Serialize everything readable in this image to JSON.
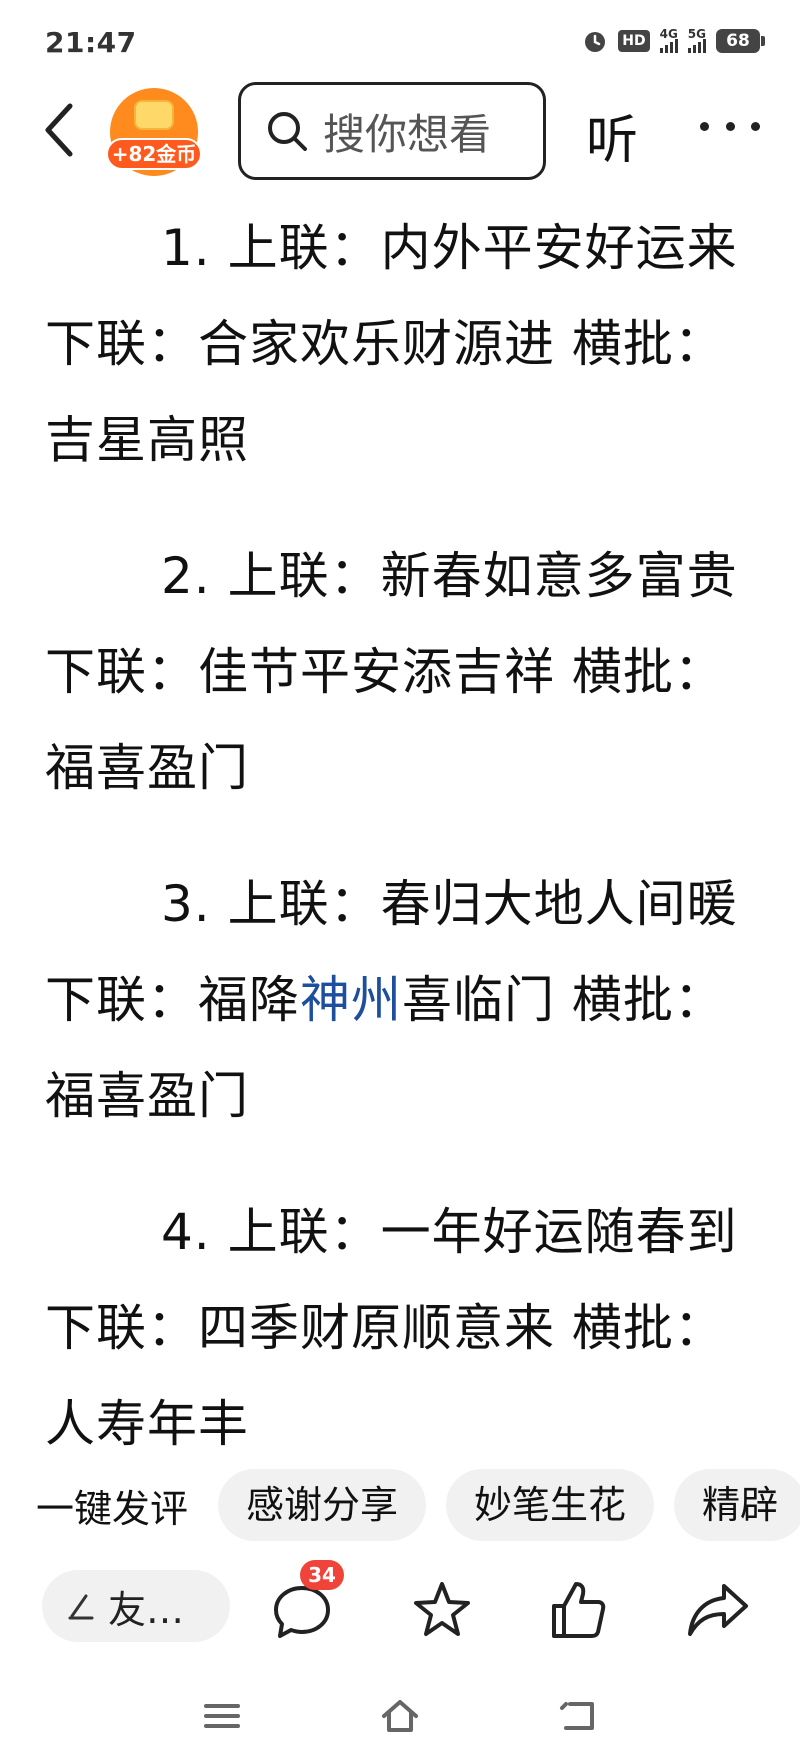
{
  "status_bar": {
    "time": "21:47",
    "hd_label": "HD",
    "network_1": "4G",
    "network_2": "5G",
    "battery": "68"
  },
  "header": {
    "back_icon": "chevron-left-icon",
    "coin_badge_label": "+82金币",
    "search_placeholder": "搜你想看",
    "listen_label": "听",
    "more_icon": "more-horizontal-icon"
  },
  "article": {
    "paragraphs": [
      {
        "text": "1. 上联：内外平安好运来 下联：合家欢乐财源进 横批：吉星高照"
      },
      {
        "text": "2. 上联：新春如意多富贵 下联：佳节平安添吉祥 横批：福喜盈门"
      },
      {
        "pre": "3. 上联：春归大地人间暖 下联：福降",
        "keyword": "神州",
        "post": "喜临门 横批：福喜盈门"
      },
      {
        "text": "4. 上联：一年好运随春到 下联：四季财原顺意来 横批：人寿年丰"
      }
    ],
    "keyword_color": "#1e4e9e"
  },
  "quick_comments": {
    "label": "一键发评",
    "chips": [
      "感谢分享",
      "妙笔生花",
      "精辟"
    ]
  },
  "action_bar": {
    "comment_placeholder": "友…",
    "comment_count": "34",
    "icons": [
      "pen-icon",
      "comment-icon",
      "star-icon",
      "like-icon",
      "share-icon"
    ]
  },
  "system_nav": {
    "icons": [
      "menu-icon",
      "home-icon",
      "back-icon"
    ]
  },
  "colors": {
    "accent": "#ff8a1e",
    "badge": "#f0443a",
    "chip_bg": "#f1f1f1"
  }
}
